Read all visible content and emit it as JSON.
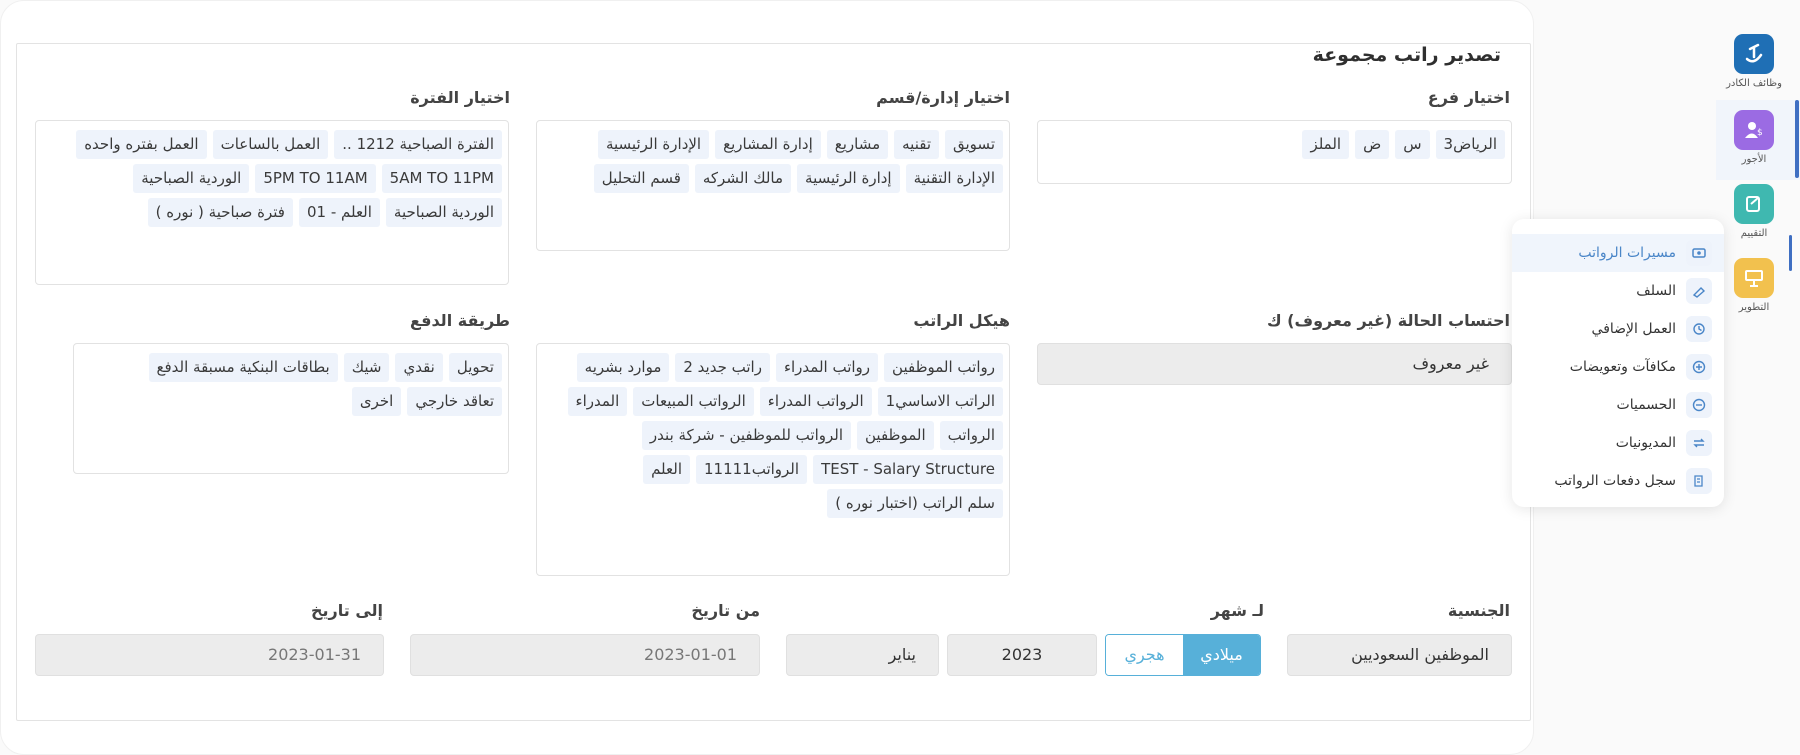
{
  "form": {
    "title": "تصدير راتب مجموعة",
    "branch": {
      "label": "اختيار فرع",
      "items": [
        "الرياض3",
        "س",
        "ض",
        "الملز"
      ]
    },
    "department": {
      "label": "اختيار إدارة/قسم",
      "items": [
        "تسويق",
        "تقنيه",
        "مشاريع",
        "إدارة المشاريع",
        "الإدارة الرئيسية",
        "الإدارة التقنية",
        "إدارة الرئيسية",
        "مالك الشركه",
        "قسم التحليل"
      ]
    },
    "period": {
      "label": "اختيار الفترة",
      "items": [
        "الفترة الصباحية 1212 ..",
        "العمل بالساعات",
        "العمل بفتره واحده",
        "5AM TO 11PM",
        "5PM TO 11AM",
        "الوردية الصباحية",
        "الوردية الصباحية",
        "العلم - 01",
        "فترة صباحية ( نوره )"
      ]
    },
    "status_calc": {
      "label": "احتساب الحالة (غير معروف) ك",
      "value": "غير معروف"
    },
    "salary_structure": {
      "label": "هيكل الراتب",
      "items": [
        "رواتب الموظفين",
        "رواتب المدراء",
        "راتب جديد 2",
        "موارد بشريه",
        "الراتب الاساسي1",
        "الرواتب المدراء",
        "الرواتب المبيعات",
        "المدراء",
        "الرواتب",
        "الموظفين",
        "الرواتب للموظفين - شركة بندر",
        "TEST - Salary Structure",
        "الرواتب11111",
        "العلم",
        "سلم الراتب (اختبار نوره )"
      ]
    },
    "payment_method": {
      "label": "طريقة الدفع",
      "items": [
        "تحويل",
        "نقدي",
        "شيك",
        "بطاقات البنكية مسبقة الدفع",
        "تعاقد خارجي",
        "اخرى"
      ]
    },
    "nationality": {
      "label": "الجنسية",
      "value": "الموظفين السعوديين"
    },
    "month": {
      "label": "لـ شهر",
      "calendar_gregorian": "ميلادي",
      "calendar_hijri": "هجري",
      "year": "2023",
      "month_name": "يناير"
    },
    "from_date": {
      "label": "من تاريخ",
      "value": "2023-01-01"
    },
    "to_date": {
      "label": "إلى تاريخ",
      "value": "2023-01-31"
    }
  },
  "rail": [
    {
      "label": "وظائف الكادر",
      "icon": "logo-icon",
      "color": "#1f6fb5"
    },
    {
      "label": "الأجور",
      "icon": "payroll-icon",
      "color": "#9b6be3"
    },
    {
      "label": "التقييم",
      "icon": "evaluation-icon",
      "color": "#3fb8b0"
    },
    {
      "label": "التطوير",
      "icon": "development-icon",
      "color": "#f2c14e"
    }
  ],
  "menu": [
    {
      "label": "مسيرات الرواتب",
      "icon": "payroll-run-icon"
    },
    {
      "label": "السلف",
      "icon": "advance-icon"
    },
    {
      "label": "العمل الإضافي",
      "icon": "overtime-icon"
    },
    {
      "label": "مكافآت وتعويضات",
      "icon": "bonus-icon"
    },
    {
      "label": "الحسميات",
      "icon": "deduction-icon"
    },
    {
      "label": "المديونيات",
      "icon": "debts-icon"
    },
    {
      "label": "سجل دفعات الرواتب",
      "icon": "payment-log-icon"
    }
  ]
}
